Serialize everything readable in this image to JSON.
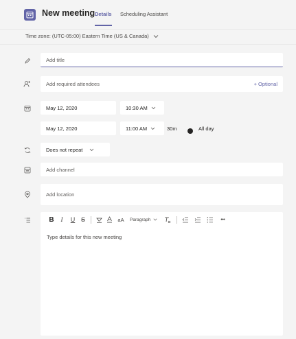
{
  "header": {
    "title": "New meeting",
    "tabs": [
      {
        "label": "Details",
        "active": true
      },
      {
        "label": "Scheduling Assistant",
        "active": false
      }
    ]
  },
  "timezone": {
    "label": "Time zone: (UTC-05:00) Eastern Time (US & Canada)"
  },
  "form": {
    "title_placeholder": "Add title",
    "attendees_placeholder": "Add required attendees",
    "optional_label": "+ Optional",
    "start_date": "May 12, 2020",
    "start_time": "10:30 AM",
    "end_date": "May 12, 2020",
    "end_time": "11:00 AM",
    "duration": "30m",
    "all_day_label": "All day",
    "all_day_on": false,
    "repeat": "Does not repeat",
    "channel_placeholder": "Add channel",
    "location_placeholder": "Add location"
  },
  "editor": {
    "toolbar": {
      "bold": "B",
      "italic": "I",
      "underline": "U",
      "strike": "S",
      "font_size": "aA",
      "paragraph": "Paragraph",
      "more": "•••"
    },
    "placeholder": "Type details for this new meeting"
  },
  "colors": {
    "accent": "#6264a7",
    "background": "#f4f4f4",
    "field": "#ffffff",
    "text": "#252423"
  }
}
